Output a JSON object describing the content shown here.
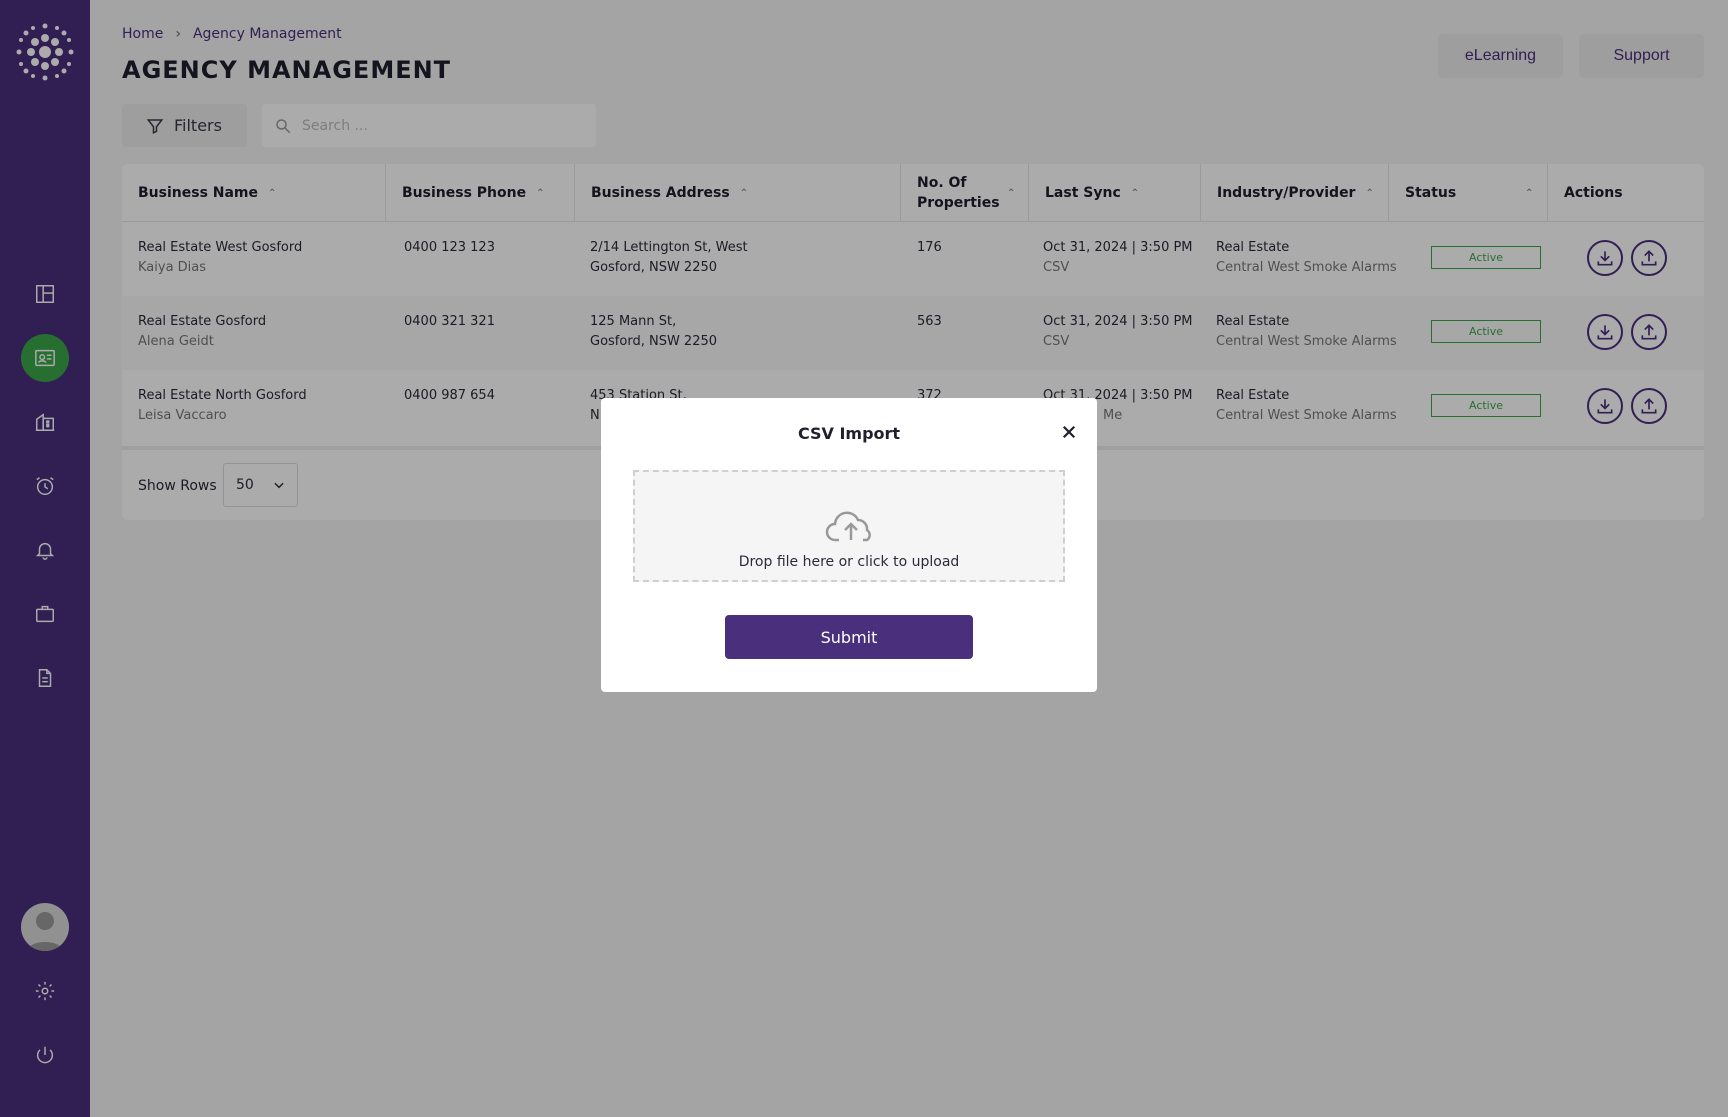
{
  "breadcrumb": {
    "home": "Home",
    "separator": "›",
    "current": "Agency Management"
  },
  "page_title": "AGENCY MANAGEMENT",
  "header_buttons": {
    "elearning": "eLearning",
    "support": "Support"
  },
  "toolbar": {
    "filters_label": "Filters",
    "search_placeholder": "Search ..."
  },
  "table": {
    "headers": [
      "Business Name",
      "Business Phone",
      "Business Address",
      "No. Of Properties",
      "Last Sync",
      "Industry/Provider",
      "Status",
      "Actions"
    ],
    "rows": [
      {
        "business_name": "Real Estate West Gosford",
        "contact": "Kaiya Dias",
        "phone": "0400 123 123",
        "address_line1": "2/14 Lettington St, West",
        "address_line2": "Gosford, NSW 2250",
        "properties": "176",
        "last_sync": "Oct 31, 2024 | 3:50 PM",
        "sync_source": "CSV",
        "industry": "Real Estate",
        "provider": "Central West Smoke Alarms",
        "status": "Active"
      },
      {
        "business_name": "Real Estate Gosford",
        "contact": "Alena Geidt",
        "phone": "0400 321 321",
        "address_line1": "125 Mann St,",
        "address_line2": "Gosford, NSW 2250",
        "properties": "563",
        "last_sync": "Oct 31, 2024 | 3:50 PM",
        "sync_source": "CSV",
        "industry": "Real Estate",
        "provider": "Central West Smoke Alarms",
        "status": "Active"
      },
      {
        "business_name": "Real Estate North Gosford",
        "contact": "Leisa Vaccaro",
        "phone": "0400 987 654",
        "address_line1": "453 Station St,",
        "address_line2": "N",
        "properties": "372",
        "last_sync": "Oct 31, 2024 | 3:50 PM",
        "sync_source": "Me",
        "industry": "Real Estate",
        "provider": "Central West Smoke Alarms",
        "status": "Active"
      }
    ],
    "show_rows_label": "Show Rows",
    "rows_per_page": "50"
  },
  "modal": {
    "title": "CSV Import",
    "drop_text": "Drop file here or click to upload",
    "submit_label": "Submit"
  },
  "colors": {
    "brand_purple": "#4a2f7c",
    "active_green": "#3aa64a"
  },
  "icons": {
    "sidebar": [
      "dashboard-icon",
      "agency-card-icon",
      "building-icon",
      "alarm-clock-icon",
      "bell-icon",
      "briefcase-icon",
      "document-icon"
    ],
    "bottom": [
      "avatar",
      "gear-icon",
      "power-icon"
    ],
    "actions": [
      "download-icon",
      "upload-icon"
    ]
  }
}
